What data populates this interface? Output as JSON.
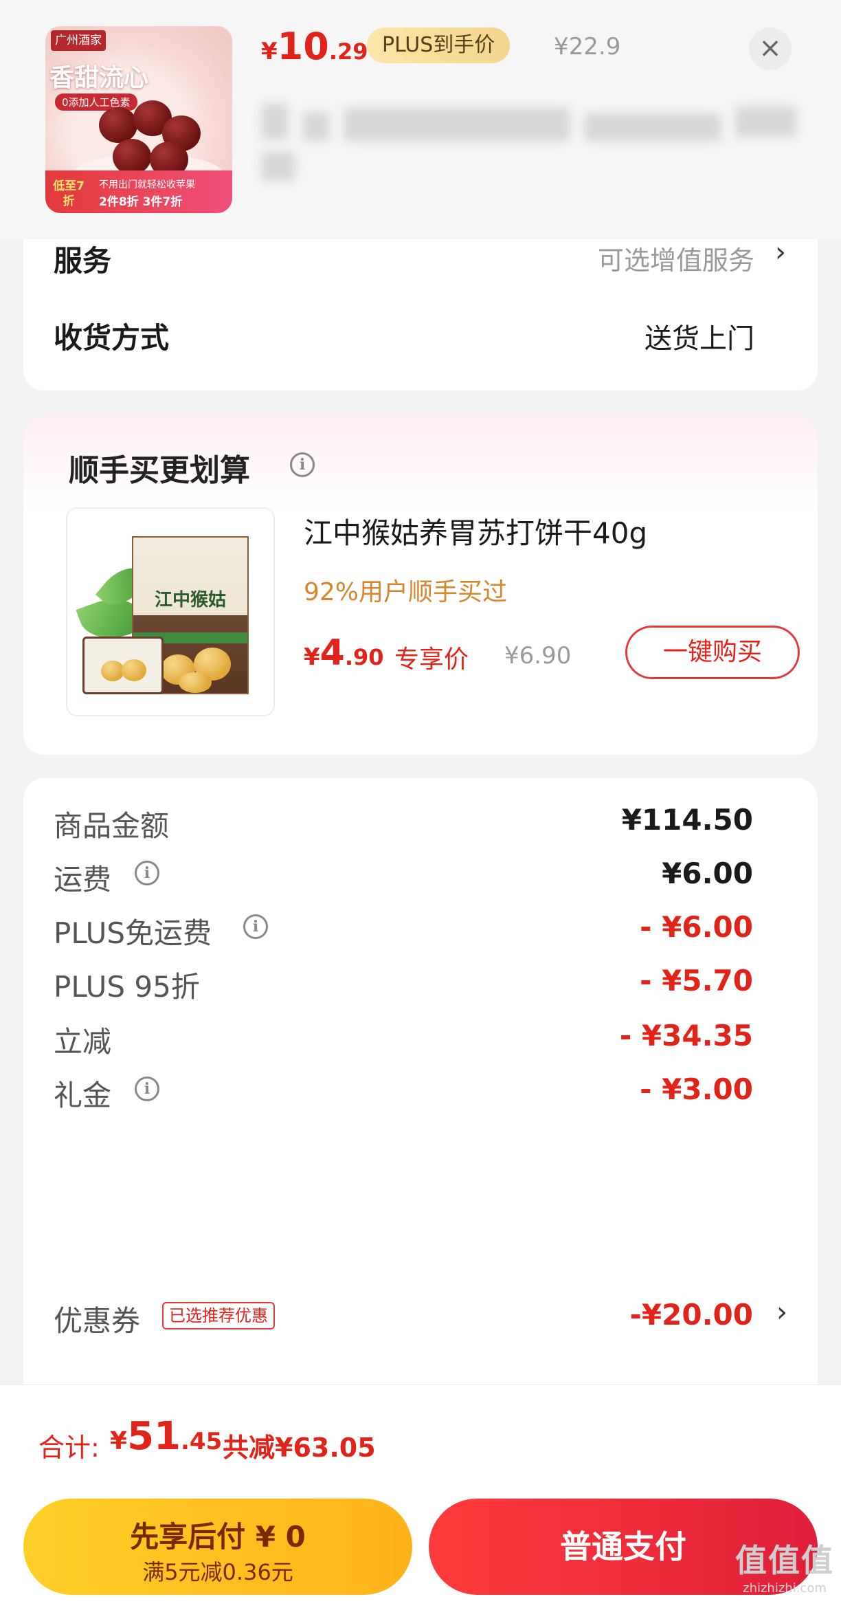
{
  "header": {
    "thumb": {
      "brand": "广州酒家",
      "headline": "香甜流心",
      "sub": "0添加人工色素",
      "promo_left": "低至7折",
      "promo_line1": "不用出门就轻松收苹果",
      "promo_line2": "2件8折 3件7折"
    },
    "price": {
      "currency": "¥",
      "int": "10",
      "dec": ".29"
    },
    "plus_label": "PLUS到手价",
    "original_price": "¥22.9",
    "close_icon": "close-icon"
  },
  "service": {
    "service_label": "服务",
    "service_value": "可选增值服务",
    "delivery_label": "收货方式",
    "delivery_value": "送货上门",
    "chevron": "›"
  },
  "addon": {
    "title": "顺手买更划算",
    "info": "i",
    "name": "江中猴姑养胃苏打饼干40g",
    "box_title": "江中猴姑",
    "tag": "92%用户顺手买过",
    "price": {
      "currency": "¥",
      "int": "4",
      "dec": ".90"
    },
    "exclusive": "专享价",
    "original_price": "¥6.90",
    "buy_label": "一键购买"
  },
  "summary": {
    "rows": [
      {
        "label": "商品金额",
        "value": "¥114.50",
        "has_info": false,
        "red": false
      },
      {
        "label": "运费",
        "value": "¥6.00",
        "has_info": true,
        "red": false
      },
      {
        "label": "PLUS免运费",
        "value": "- ¥6.00",
        "has_info": true,
        "red": true
      },
      {
        "label": "PLUS 95折",
        "value": "- ¥5.70",
        "has_info": false,
        "red": true
      },
      {
        "label": "立减",
        "value": "- ¥34.35",
        "has_info": false,
        "red": true
      },
      {
        "label": "礼金",
        "value": "- ¥3.00",
        "has_info": true,
        "red": true
      },
      {
        "label": "优惠券",
        "value": "-¥20.00",
        "has_info": false,
        "red": true
      }
    ],
    "coupon_tag": "已选推荐优惠",
    "chevron": "›",
    "info": "i"
  },
  "total": {
    "label": "合计:",
    "amount": {
      "currency": "¥",
      "int": "51",
      "dec": ".45"
    },
    "saved": "共减¥63.05"
  },
  "pay": {
    "later_line1": "先享后付 ¥ 0",
    "later_line2": "满5元减0.36元",
    "pay_label": "普通支付"
  },
  "watermark": {
    "logo": "值值值",
    "url": "zhizhizhi.com"
  },
  "colors": {
    "accent_red": "#e2231a",
    "plus_gold": "#f4d58e",
    "later_yellow": "#ffb21a"
  }
}
